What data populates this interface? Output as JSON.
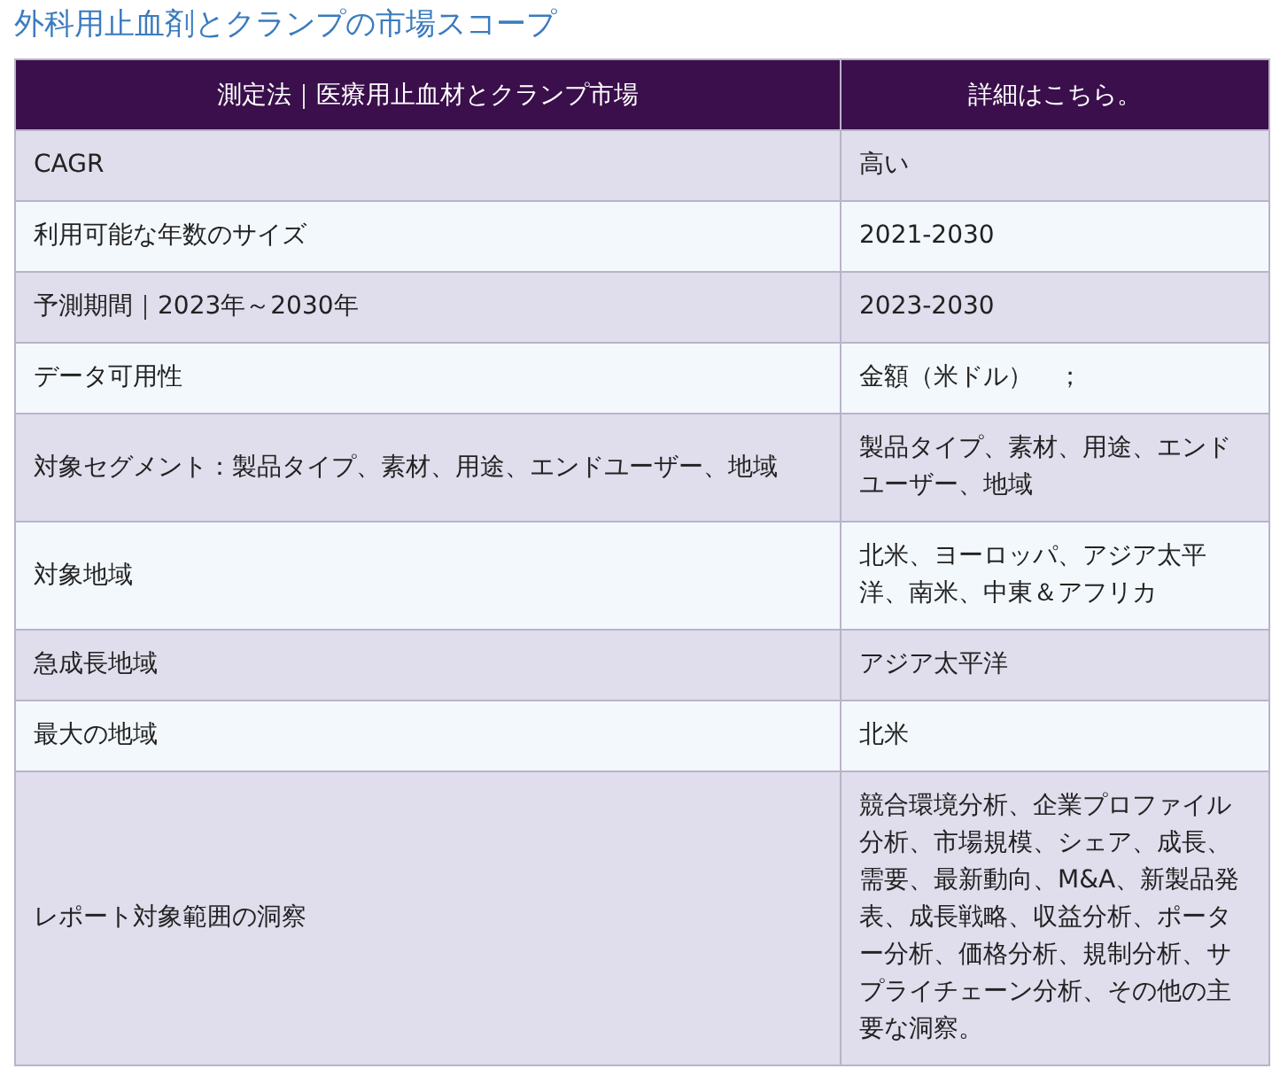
{
  "title": "外科用止血剤とクランプの市場スコープ",
  "table": {
    "columns": [
      "測定法｜医療用止血材とクランプ市場",
      "詳細はこちら。"
    ],
    "rows": [
      {
        "label": "CAGR",
        "value": "高い"
      },
      {
        "label": "利用可能な年数のサイズ",
        "value": "2021-2030"
      },
      {
        "label": "予測期間｜2023年～2030年",
        "value": "2023-2030"
      },
      {
        "label": "データ可用性",
        "value": "金額（米ドル）　；"
      },
      {
        "label": "対象セグメント：製品タイプ、素材、用途、エンドユーザー、地域",
        "value": "製品タイプ、素材、用途、エンドユーザー、地域"
      },
      {
        "label": "対象地域",
        "value": "北米、ヨーロッパ、アジア太平洋、南米、中東＆アフリカ"
      },
      {
        "label": "急成長地域",
        "value": "アジア太平洋"
      },
      {
        "label": "最大の地域",
        "value": "北米"
      },
      {
        "label": "レポート対象範囲の洞察",
        "value": "競合環境分析、企業プロファイル分析、市場規模、シェア、成長、需要、最新動向、M&A、新製品発表、成長戦略、収益分析、ポーター分析、価格分析、規制分析、サプライチェーン分析、その他の主要な洞察。"
      }
    ]
  }
}
